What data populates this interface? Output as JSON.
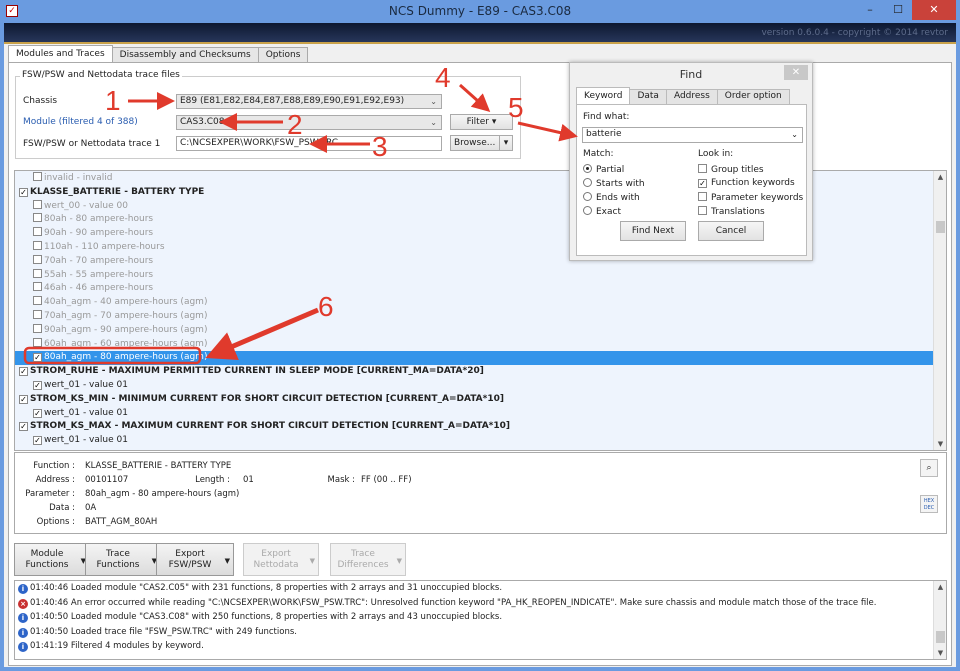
{
  "window": {
    "title": "NCS Dummy - E89 - CAS3.C08",
    "version": "version 0.6.0.4 - copyright © 2014 revtor",
    "minimize": "–",
    "maximize": "☐",
    "close": "✕"
  },
  "tabs": [
    {
      "label": "Modules and Traces",
      "active": true
    },
    {
      "label": "Disassembly and Checksums"
    },
    {
      "label": "Options"
    }
  ],
  "trace_files": {
    "group_title": "FSW/PSW and Nettodata trace files",
    "chassis_label": "Chassis",
    "chassis_value": "E89  (E81,E82,E84,E87,E88,E89,E90,E91,E92,E93)",
    "module_label": "Module (filtered 4 of 388)",
    "module_value": "CAS3.C08",
    "trace_label": "FSW/PSW or Nettodata trace 1",
    "trace_value": "C:\\NCSEXPER\\WORK\\FSW_PSW.TRC",
    "filter_button": "Filter",
    "browse_button": "Browse..."
  },
  "tree": [
    {
      "type": "opt",
      "checked": false,
      "dim": true,
      "text": "invalid  -  invalid"
    },
    {
      "type": "grp",
      "checked": true,
      "text": "KLASSE_BATTERIE  -  BATTERY TYPE"
    },
    {
      "type": "opt",
      "checked": false,
      "dim": true,
      "text": "wert_00  -  value 00"
    },
    {
      "type": "opt",
      "checked": false,
      "dim": true,
      "text": "80ah  -  80 ampere-hours"
    },
    {
      "type": "opt",
      "checked": false,
      "dim": true,
      "text": "90ah  -  90 ampere-hours"
    },
    {
      "type": "opt",
      "checked": false,
      "dim": true,
      "text": "110ah  -  110 ampere-hours"
    },
    {
      "type": "opt",
      "checked": false,
      "dim": true,
      "text": "70ah  -  70 ampere-hours"
    },
    {
      "type": "opt",
      "checked": false,
      "dim": true,
      "text": "55ah  -  55 ampere-hours"
    },
    {
      "type": "opt",
      "checked": false,
      "dim": true,
      "text": "46ah  -  46 ampere-hours"
    },
    {
      "type": "opt",
      "checked": false,
      "dim": true,
      "text": "40ah_agm  -  40 ampere-hours (agm)"
    },
    {
      "type": "opt",
      "checked": false,
      "dim": true,
      "text": "70ah_agm  -  70 ampere-hours (agm)"
    },
    {
      "type": "opt",
      "checked": false,
      "dim": true,
      "text": "90ah_agm  -  90 ampere-hours (agm)"
    },
    {
      "type": "opt",
      "checked": false,
      "dim": true,
      "text": "60ah_agm  -  60 ampere-hours (agm)"
    },
    {
      "type": "opt",
      "checked": true,
      "selected": true,
      "text": "80ah_agm  -  80 ampere-hours (agm)"
    },
    {
      "type": "grp",
      "checked": true,
      "text": "STROM_RUHE  -  MAXIMUM PERMITTED CURRENT IN SLEEP MODE [CURRENT_MA=DATA*20]"
    },
    {
      "type": "opt",
      "checked": true,
      "text": "wert_01  -  value 01"
    },
    {
      "type": "grp",
      "checked": true,
      "text": "STROM_KS_MIN  -  MINIMUM CURRENT FOR SHORT CIRCUIT DETECTION [CURRENT_A=DATA*10]"
    },
    {
      "type": "opt",
      "checked": true,
      "text": "wert_01  -  value 01"
    },
    {
      "type": "grp",
      "checked": true,
      "text": "STROM_KS_MAX  -  MAXIMUM CURRENT FOR SHORT CIRCUIT DETECTION [CURRENT_A=DATA*10]"
    },
    {
      "type": "opt",
      "checked": true,
      "text": "wert_01  -  value 01"
    }
  ],
  "detail": {
    "function_label": "Function :",
    "function_value": "KLASSE_BATTERIE  -  BATTERY TYPE",
    "address_label": "Address :",
    "address_value": "00101107",
    "length_label": "Length :",
    "length_value": "01",
    "mask_label": "Mask :",
    "mask_value": "FF  (00 .. FF)",
    "parameter_label": "Parameter :",
    "parameter_value": "80ah_agm  -  80 ampere-hours (agm)",
    "data_label": "Data :",
    "data_value": "0A",
    "options_label": "Options :",
    "options_value": "BATT_AGM_80AH",
    "hexdec_label": "HEX DEC"
  },
  "actions": [
    {
      "line1": "Module",
      "line2": "Functions",
      "enabled": true
    },
    {
      "line1": "Trace",
      "line2": "Functions",
      "enabled": true
    },
    {
      "line1": "Export",
      "line2": "FSW/PSW",
      "enabled": true
    },
    {
      "line1": "Export",
      "line2": "Nettodata",
      "enabled": false
    },
    {
      "line1": "Trace",
      "line2": "Differences",
      "enabled": false
    }
  ],
  "log": [
    {
      "level": "info",
      "text": "01:40:46  Loaded module \"CAS2.C05\" with 231 functions, 8 properties with 2 arrays and 31 unoccupied blocks."
    },
    {
      "level": "error",
      "text": "01:40:46  An error occurred while reading \"C:\\NCSEXPER\\WORK\\FSW_PSW.TRC\": Unresolved function keyword \"PA_HK_REOPEN_INDICATE\". Make sure chassis and module match those of the trace file."
    },
    {
      "level": "info",
      "text": "01:40:50  Loaded module \"CAS3.C08\" with 250 functions, 8 properties with 2 arrays and 43 unoccupied blocks."
    },
    {
      "level": "info",
      "text": "01:40:50  Loaded trace file \"FSW_PSW.TRC\" with 249 functions."
    },
    {
      "level": "info",
      "text": "01:41:19  Filtered 4 modules by keyword."
    }
  ],
  "find": {
    "title": "Find",
    "close": "✕",
    "tabs": [
      {
        "label": "Keyword",
        "active": true
      },
      {
        "label": "Data"
      },
      {
        "label": "Address"
      },
      {
        "label": "Order option"
      }
    ],
    "find_what_label": "Find what:",
    "find_what_value": "batterie",
    "match_label": "Match:",
    "match": [
      {
        "label": "Partial",
        "selected": true
      },
      {
        "label": "Starts with"
      },
      {
        "label": "Ends with"
      },
      {
        "label": "Exact"
      }
    ],
    "look_in_label": "Look in:",
    "look_in": [
      {
        "label": "Group titles",
        "checked": false
      },
      {
        "label": "Function keywords",
        "checked": true
      },
      {
        "label": "Parameter keywords",
        "checked": false
      },
      {
        "label": "Translations",
        "checked": false
      }
    ],
    "find_next": "Find Next",
    "cancel": "Cancel"
  },
  "annotations": {
    "color": "#e03a2c",
    "labels": [
      "1",
      "2",
      "3",
      "4",
      "5",
      "6"
    ]
  }
}
